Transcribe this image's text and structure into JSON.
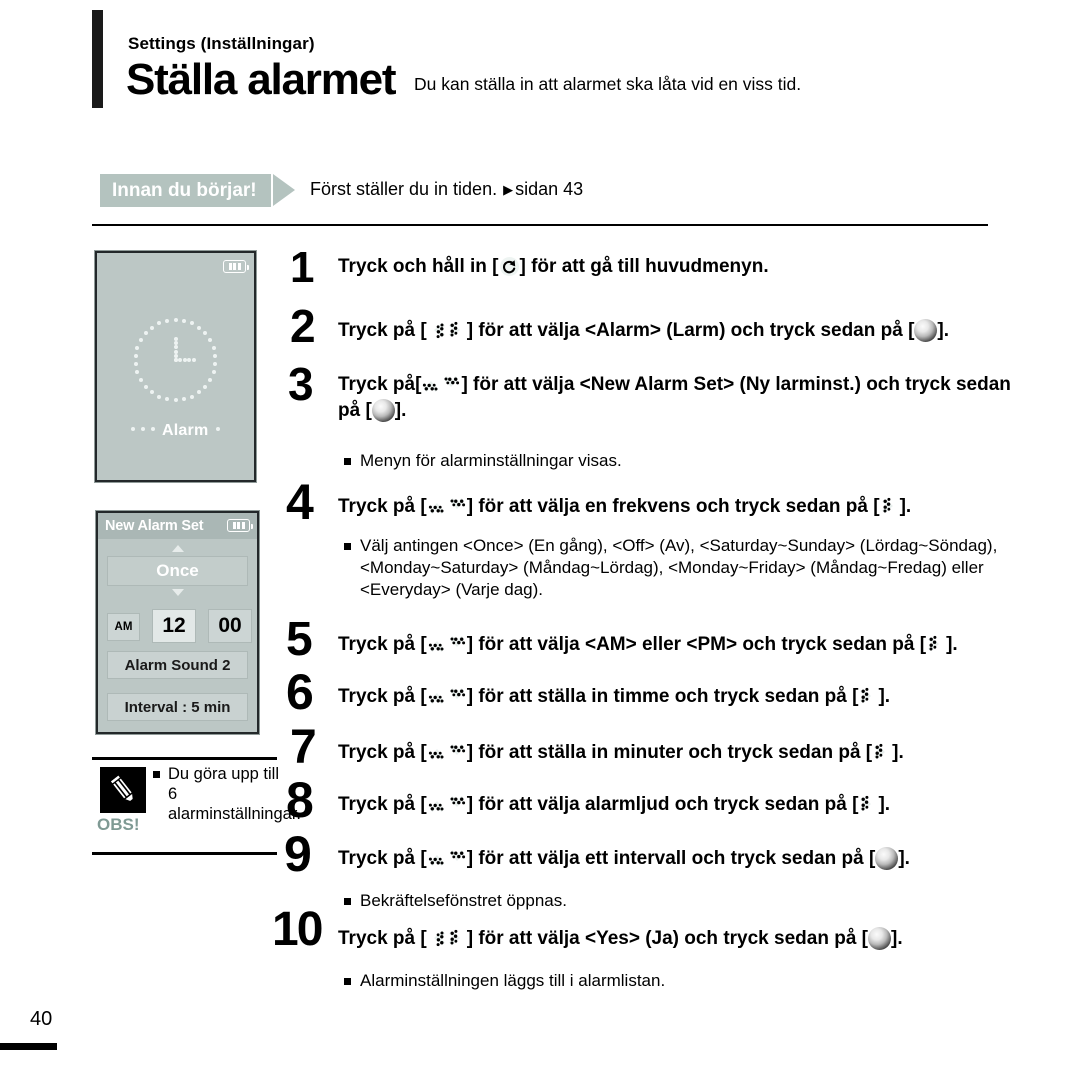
{
  "header": {
    "eyebrow": "Settings (Inställningar)",
    "title": "Ställa alarmet",
    "description": "Du kan ställa in att alarmet ska låta vid en viss tid.",
    "rule_color": "#1a1a1a"
  },
  "before_you_begin": {
    "tag_label": "Innan du börjar!",
    "tag_color": "#b4c3bf",
    "text": "Först ställer du in tiden.",
    "arrow_glyph": "▶",
    "reference": "sidan 43"
  },
  "devices": [
    {
      "name": "alarm-splash-screen",
      "battery_icon": "battery-icon",
      "clock_icon": "clock-icon",
      "label": "Alarm",
      "screen_color": "#bcc7c5"
    },
    {
      "name": "new-alarm-set-screen",
      "title": "New Alarm Set",
      "battery_icon": "battery-icon",
      "frequency": "Once",
      "ampm": "AM",
      "hour": "12",
      "minute": "00",
      "sound": "Alarm Sound 2",
      "interval": "Interval : 5 min",
      "screen_color": "#bcc7c5"
    }
  ],
  "note": {
    "icon": "pencil-icon",
    "label": "OBS!",
    "text": "Du göra upp till 6 alarminställningar."
  },
  "steps": [
    {
      "num": "1",
      "parts": [
        {
          "t": "text",
          "v": "Tryck och håll in ["
        },
        {
          "t": "icon",
          "v": "return-icon"
        },
        {
          "t": "text",
          "v": "] för att gå till huvudmenyn."
        }
      ],
      "substeps": []
    },
    {
      "num": "2",
      "parts": [
        {
          "t": "text",
          "v": "Tryck på ["
        },
        {
          "t": "icon",
          "v": "left-icon"
        },
        {
          "t": "icon",
          "v": "right-icon"
        },
        {
          "t": "text",
          "v": "] för att välja <Alarm> (Larm) och tryck sedan på ["
        },
        {
          "t": "icon",
          "v": "select-icon"
        },
        {
          "t": "text",
          "v": "]."
        }
      ],
      "substeps": []
    },
    {
      "num": "3",
      "parts": [
        {
          "t": "text",
          "v": "Tryck på["
        },
        {
          "t": "icon",
          "v": "up-icon"
        },
        {
          "t": "icon",
          "v": "down-icon"
        },
        {
          "t": "text",
          "v": "] för att välja <New Alarm Set> (Ny larminst.) och tryck sedan på ["
        },
        {
          "t": "icon",
          "v": "select-icon"
        },
        {
          "t": "text",
          "v": "]."
        }
      ],
      "substeps": [
        "Menyn för alarminställningar visas."
      ]
    },
    {
      "num": "4",
      "parts": [
        {
          "t": "text",
          "v": "Tryck på ["
        },
        {
          "t": "icon",
          "v": "up-icon"
        },
        {
          "t": "icon",
          "v": "down-icon"
        },
        {
          "t": "text",
          "v": "] för att välja en frekvens och tryck sedan på ["
        },
        {
          "t": "icon",
          "v": "right-icon"
        },
        {
          "t": "text",
          "v": "]."
        }
      ],
      "substeps": [
        "Välj antingen <Once> (En gång), <Off> (Av), <Saturday~Sunday> (Lördag~Söndag), <Monday~Saturday> (Måndag~Lördag), <Monday~Friday> (Måndag~Fredag) eller <Everyday> (Varje dag)."
      ]
    },
    {
      "num": "5",
      "parts": [
        {
          "t": "text",
          "v": "Tryck på ["
        },
        {
          "t": "icon",
          "v": "up-icon"
        },
        {
          "t": "icon",
          "v": "down-icon"
        },
        {
          "t": "text",
          "v": "] för att välja <AM> eller <PM> och tryck sedan på ["
        },
        {
          "t": "icon",
          "v": "right-icon"
        },
        {
          "t": "text",
          "v": "]."
        }
      ],
      "substeps": []
    },
    {
      "num": "6",
      "parts": [
        {
          "t": "text",
          "v": "Tryck på ["
        },
        {
          "t": "icon",
          "v": "up-icon"
        },
        {
          "t": "icon",
          "v": "down-icon"
        },
        {
          "t": "text",
          "v": "] för att ställa in timme och tryck sedan på ["
        },
        {
          "t": "icon",
          "v": "right-icon"
        },
        {
          "t": "text",
          "v": "]."
        }
      ],
      "substeps": []
    },
    {
      "num": "7",
      "parts": [
        {
          "t": "text",
          "v": "Tryck på ["
        },
        {
          "t": "icon",
          "v": "up-icon"
        },
        {
          "t": "icon",
          "v": "down-icon"
        },
        {
          "t": "text",
          "v": "] för att ställa in minuter och tryck sedan på ["
        },
        {
          "t": "icon",
          "v": "right-icon"
        },
        {
          "t": "text",
          "v": "]."
        }
      ],
      "substeps": []
    },
    {
      "num": "8",
      "parts": [
        {
          "t": "text",
          "v": "Tryck på ["
        },
        {
          "t": "icon",
          "v": "up-icon"
        },
        {
          "t": "icon",
          "v": "down-icon"
        },
        {
          "t": "text",
          "v": "] för att välja alarmljud och tryck sedan på  ["
        },
        {
          "t": "icon",
          "v": "right-icon"
        },
        {
          "t": "text",
          "v": "]."
        }
      ],
      "substeps": []
    },
    {
      "num": "9",
      "parts": [
        {
          "t": "text",
          "v": "Tryck på ["
        },
        {
          "t": "icon",
          "v": "up-icon"
        },
        {
          "t": "icon",
          "v": "down-icon"
        },
        {
          "t": "text",
          "v": "] för att välja ett intervall och tryck sedan på ["
        },
        {
          "t": "icon",
          "v": "select-icon"
        },
        {
          "t": "text",
          "v": "]."
        }
      ],
      "substeps": [
        "Bekräftelsefönstret öppnas."
      ]
    },
    {
      "num": "10",
      "parts": [
        {
          "t": "text",
          "v": "Tryck på ["
        },
        {
          "t": "icon",
          "v": "left-icon"
        },
        {
          "t": "icon",
          "v": "right-icon"
        },
        {
          "t": "text",
          "v": "] för att välja <Yes> (Ja) och tryck sedan på  ["
        },
        {
          "t": "icon",
          "v": "select-icon"
        },
        {
          "t": "text",
          "v": "]."
        }
      ],
      "substeps": [
        "Alarminställningen läggs till i alarmlistan."
      ]
    }
  ],
  "footer": {
    "page_number": "40"
  }
}
